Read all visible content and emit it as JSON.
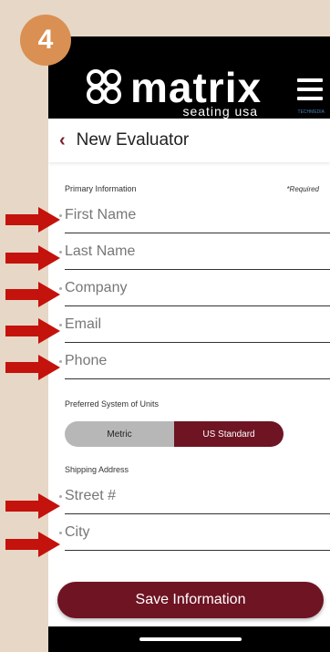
{
  "step_badge": "4",
  "header": {
    "logo_word": "matrix",
    "logo_sub": "seating usa",
    "corner_mark": "TECHMEDIA"
  },
  "title_bar": {
    "back": "‹",
    "title": "New Evaluator"
  },
  "primary": {
    "label": "Primary Information",
    "required": "*Required",
    "fields": [
      {
        "placeholder": "First Name"
      },
      {
        "placeholder": "Last Name"
      },
      {
        "placeholder": "Company"
      },
      {
        "placeholder": "Email"
      },
      {
        "placeholder": "Phone"
      }
    ]
  },
  "units": {
    "label": "Preferred System of Units",
    "options": [
      "Metric",
      "US Standard"
    ],
    "selected": "US Standard"
  },
  "shipping": {
    "label": "Shipping Address",
    "fields": [
      {
        "placeholder": "Street #"
      },
      {
        "placeholder": "City"
      }
    ]
  },
  "save_label": "Save Information",
  "colors": {
    "accent": "#6e1423",
    "badge": "#d99052",
    "arrow": "#c4120c"
  },
  "icons": {
    "arrow": "red-arrow-icon",
    "menu": "hamburger-menu-icon",
    "back": "chevron-left-icon"
  }
}
